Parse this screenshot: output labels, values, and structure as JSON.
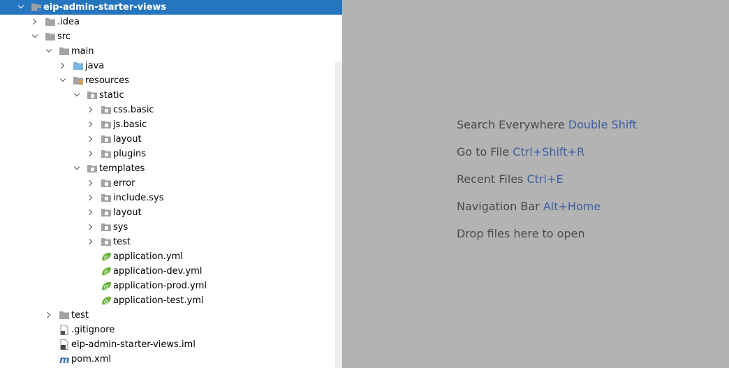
{
  "project_tree": {
    "nodes": [
      {
        "label": "eip-admin-starter-views",
        "depth": 0,
        "chevron": "expanded",
        "icon": "module-folder-icon",
        "selected": true
      },
      {
        "label": ".idea",
        "depth": 1,
        "chevron": "collapsed",
        "icon": "folder-icon"
      },
      {
        "label": "src",
        "depth": 1,
        "chevron": "expanded",
        "icon": "folder-icon"
      },
      {
        "label": "main",
        "depth": 2,
        "chevron": "expanded",
        "icon": "folder-icon"
      },
      {
        "label": "java",
        "depth": 3,
        "chevron": "collapsed",
        "icon": "source-folder-icon"
      },
      {
        "label": "resources",
        "depth": 3,
        "chevron": "expanded",
        "icon": "resources-folder-icon"
      },
      {
        "label": "static",
        "depth": 4,
        "chevron": "expanded",
        "icon": "package-folder-icon"
      },
      {
        "label": "css.basic",
        "depth": 5,
        "chevron": "collapsed",
        "icon": "package-folder-icon"
      },
      {
        "label": "js.basic",
        "depth": 5,
        "chevron": "collapsed",
        "icon": "package-folder-icon"
      },
      {
        "label": "layout",
        "depth": 5,
        "chevron": "collapsed",
        "icon": "package-folder-icon"
      },
      {
        "label": "plugins",
        "depth": 5,
        "chevron": "collapsed",
        "icon": "package-folder-icon"
      },
      {
        "label": "templates",
        "depth": 4,
        "chevron": "expanded",
        "icon": "package-folder-icon"
      },
      {
        "label": "error",
        "depth": 5,
        "chevron": "collapsed",
        "icon": "package-folder-icon"
      },
      {
        "label": "include.sys",
        "depth": 5,
        "chevron": "collapsed",
        "icon": "package-folder-icon"
      },
      {
        "label": "layout",
        "depth": 5,
        "chevron": "collapsed",
        "icon": "package-folder-icon"
      },
      {
        "label": "sys",
        "depth": 5,
        "chevron": "collapsed",
        "icon": "package-folder-icon"
      },
      {
        "label": "test",
        "depth": 5,
        "chevron": "collapsed",
        "icon": "package-folder-icon"
      },
      {
        "label": "application.yml",
        "depth": 5,
        "chevron": "none",
        "icon": "spring-yml-icon"
      },
      {
        "label": "application-dev.yml",
        "depth": 5,
        "chevron": "none",
        "icon": "spring-yml-icon"
      },
      {
        "label": "application-prod.yml",
        "depth": 5,
        "chevron": "none",
        "icon": "spring-yml-icon"
      },
      {
        "label": "application-test.yml",
        "depth": 5,
        "chevron": "none",
        "icon": "spring-yml-icon"
      },
      {
        "label": "test",
        "depth": 2,
        "chevron": "collapsed",
        "icon": "folder-icon"
      },
      {
        "label": ".gitignore",
        "depth": 2,
        "chevron": "none",
        "icon": "gitignore-file-icon"
      },
      {
        "label": "eip-admin-starter-views.iml",
        "depth": 2,
        "chevron": "none",
        "icon": "iml-file-icon"
      },
      {
        "label": "pom.xml",
        "depth": 2,
        "chevron": "none",
        "icon": "maven-pom-icon"
      }
    ]
  },
  "editor_hints": [
    {
      "text": "Search Everywhere",
      "key": "Double Shift"
    },
    {
      "text": "Go to File",
      "key": "Ctrl+Shift+R"
    },
    {
      "text": "Recent Files",
      "key": "Ctrl+E"
    },
    {
      "text": "Navigation Bar",
      "key": "Alt+Home"
    },
    {
      "text": "Drop files here to open",
      "key": ""
    }
  ],
  "colors": {
    "selection": "#2675bf",
    "editor_background": "#b3b3b3",
    "hint_text": "#4a4a4a",
    "hint_key": "#3d5fa0",
    "folder": "#a3a3a3",
    "source_folder": "#7ab6e0",
    "spring_green": "#6db33f"
  }
}
